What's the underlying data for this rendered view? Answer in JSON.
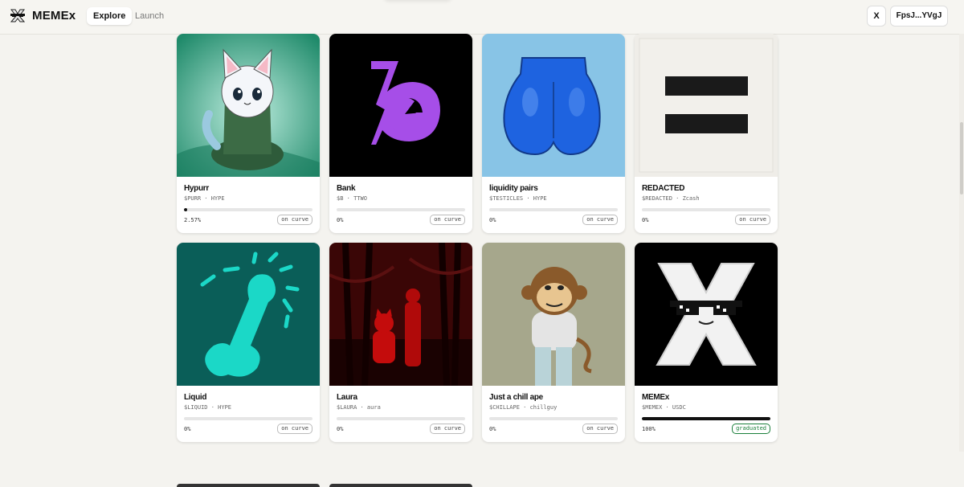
{
  "header": {
    "brand": "MEMEx",
    "nav": [
      "Explore",
      "Launch"
    ],
    "x_label": "X",
    "wallet": "FpsJ...YVgJ"
  },
  "tokens": [
    {
      "name": "Hypurr",
      "ticker": "$PURR · HYPE",
      "progress_pct": "2.57%",
      "progress": 2.57,
      "status": "on curve"
    },
    {
      "name": "Bank",
      "ticker": "$B · TTWO",
      "progress_pct": "0%",
      "progress": 0,
      "status": "on curve"
    },
    {
      "name": "liquidity pairs",
      "ticker": "$TESTICLES · HYPE",
      "progress_pct": "0%",
      "progress": 0,
      "status": "on curve"
    },
    {
      "name": "REDACTED",
      "ticker": "$REDACTED · Zcash",
      "progress_pct": "0%",
      "progress": 0,
      "status": "on curve"
    },
    {
      "name": "Liquid",
      "ticker": "$LIQUID · HYPE",
      "progress_pct": "0%",
      "progress": 0,
      "status": "on curve"
    },
    {
      "name": "Laura",
      "ticker": "$LAURA · aura",
      "progress_pct": "0%",
      "progress": 0,
      "status": "on curve"
    },
    {
      "name": "Just a chill ape",
      "ticker": "$CHILLAPE · chillguy",
      "progress_pct": "0%",
      "progress": 0,
      "status": "on curve"
    },
    {
      "name": "MEMEx",
      "ticker": "$MEMEX · USDC",
      "progress_pct": "100%",
      "progress": 100,
      "status": "graduated"
    }
  ]
}
